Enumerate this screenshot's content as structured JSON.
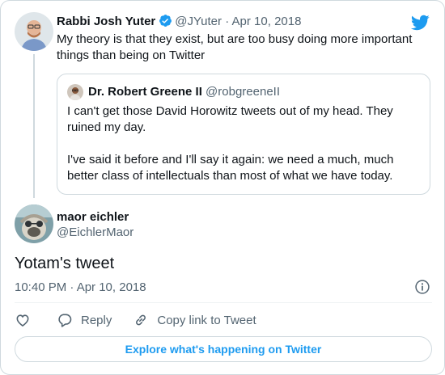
{
  "colors": {
    "accent": "#1d9bf0",
    "text_primary": "#0f1419",
    "text_secondary": "#536471",
    "border": "#cfd9de"
  },
  "icons": {
    "brand": "twitter-bird-icon",
    "verified": "verified-badge-icon",
    "info": "info-icon",
    "like": "heart-icon",
    "reply": "reply-bubble-icon",
    "copy_link": "link-icon"
  },
  "parent_tweet": {
    "author_name": "Rabbi Josh Yuter",
    "author_handle": "@JYuter",
    "separator": "·",
    "date": "Apr 10, 2018",
    "text": "My theory is that they exist, but are too busy doing more important things than being on Twitter"
  },
  "quoted_tweet": {
    "author_name": "Dr. Robert Greene II",
    "author_handle": "@robgreeneII",
    "paragraphs": [
      "I can't get those David Horowitz tweets out of my head. They ruined my day.",
      "I've said it before and I'll say it again: we need a much, much better class of intellectuals than most of what we have today."
    ]
  },
  "main_tweet": {
    "author_name": "maor eichler",
    "author_handle": "@EichlerMaor",
    "text": "Yotam's tweet",
    "timestamp": "10:40 PM · Apr 10, 2018"
  },
  "actions": {
    "reply_label": "Reply",
    "copy_link_label": "Copy link to Tweet"
  },
  "explore_label": "Explore what's happening on Twitter"
}
